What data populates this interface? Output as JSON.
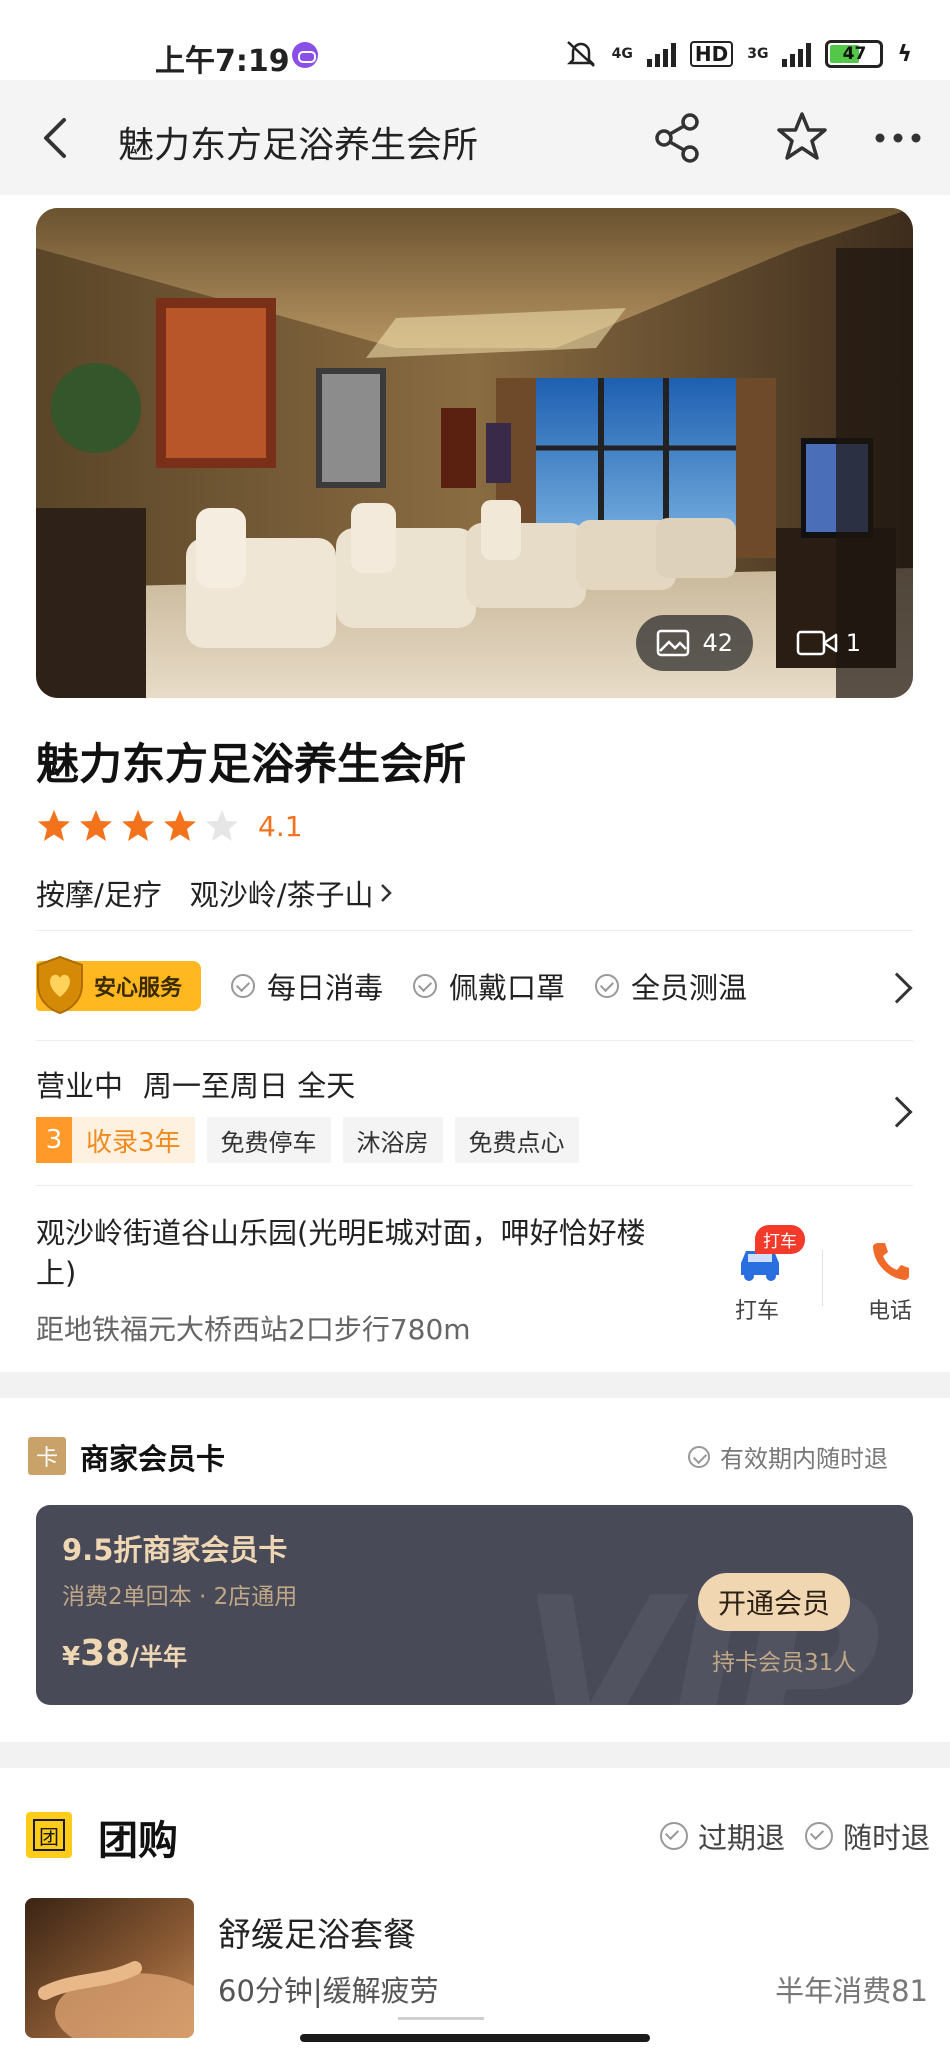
{
  "status_bar": {
    "time": "上午7:19",
    "net1": "4G",
    "hd": "HD",
    "net2": "3G",
    "battery": "47"
  },
  "header": {
    "title": "魅力东方足浴养生会所"
  },
  "hero": {
    "photo_count": "42",
    "video_count": "1"
  },
  "shop": {
    "name": "魅力东方足浴养生会所",
    "rating": "4.1",
    "rating_stars": 4,
    "category": "按摩/足疗",
    "district": "观沙岭/茶子山"
  },
  "safety": {
    "badge": "安心服务",
    "items": [
      "每日消毒",
      "佩戴口罩",
      "全员测温"
    ]
  },
  "hours": {
    "status": "营业中",
    "schedule": "周一至周日 全天"
  },
  "tags": {
    "years_num": "3",
    "years_text": "收录3年",
    "items": [
      "免费停车",
      "沐浴房",
      "免费点心"
    ]
  },
  "address": {
    "text": "观沙岭街道谷山乐园(光明E城对面，呷好恰好楼上)",
    "metro": "距地铁福元大桥西站2口步行780m"
  },
  "actions": {
    "taxi_badge": "打车",
    "taxi_label": "打车",
    "phone_label": "电话"
  },
  "member_card": {
    "section_icon": "卡",
    "section_title": "商家会员卡",
    "refund": "有效期内随时退",
    "title": "9.5折商家会员卡",
    "desc": "消费2单回本 · 2店通用",
    "price_currency": "¥",
    "price_amount": "38",
    "price_period": "/半年",
    "join_label": "开通会员",
    "holders": "持卡会员31人",
    "watermark": "VIP"
  },
  "group_buy": {
    "icon": "团",
    "title": "团购",
    "policies": [
      "过期退",
      "随时退"
    ],
    "deal_name": "舒缓足浴套餐",
    "deal_desc": "60分钟|缓解疲劳",
    "deal_sales": "半年消费81"
  },
  "colors": {
    "accent_orange": "#f2731c",
    "gold_badge": "#ffb81f",
    "vip_card_bg": "#484a58",
    "vip_gold": "#f0d7b4"
  }
}
